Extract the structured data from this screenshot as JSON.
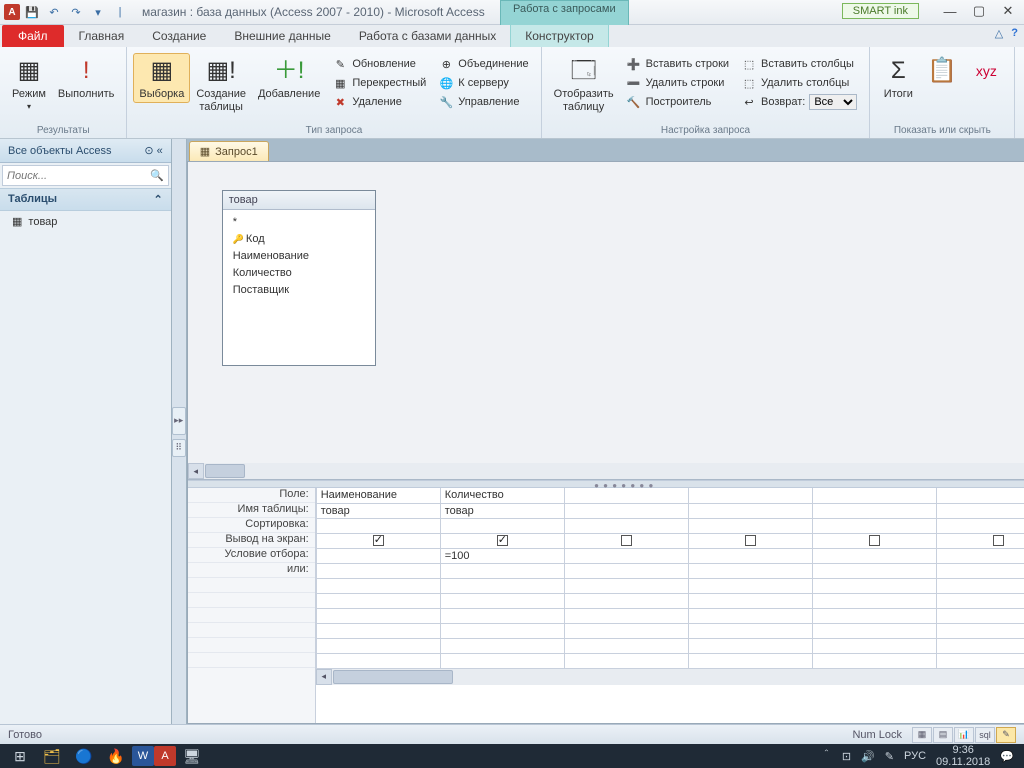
{
  "title_bar": {
    "app_title": "магазин : база данных (Access 2007 - 2010)  -  Microsoft Access",
    "context_tab_title": "Работа с запросами",
    "smart_ink": "SMART ink"
  },
  "ribbon_tabs": {
    "file": "Файл",
    "home": "Главная",
    "create": "Создание",
    "external": "Внешние данные",
    "db_tools": "Работа с базами данных",
    "designer": "Конструктор"
  },
  "ribbon": {
    "results": {
      "label": "Результаты",
      "view": "Режим",
      "run": "Выполнить"
    },
    "query_type": {
      "label": "Тип запроса",
      "select": "Выборка",
      "make_table": "Создание\nтаблицы",
      "append": "Добавление",
      "update": "Обновление",
      "crosstab": "Перекрестный",
      "delete": "Удаление",
      "union": "Объединение",
      "passthrough": "К серверу",
      "data_def": "Управление"
    },
    "setup": {
      "label": "Настройка запроса",
      "show_table": "Отобразить\nтаблицу",
      "insert_rows": "Вставить строки",
      "delete_rows": "Удалить строки",
      "builder": "Построитель",
      "insert_cols": "Вставить столбцы",
      "delete_cols": "Удалить столбцы",
      "return": "Возврат:",
      "return_val": "Все"
    },
    "show_hide": {
      "label": "Показать или скрыть",
      "totals": "Итоги"
    }
  },
  "nav": {
    "header": "Все объекты Access",
    "search_ph": "Поиск...",
    "cat_tables": "Таблицы",
    "item_tovar": "товар"
  },
  "doc": {
    "tab": "Запрос1"
  },
  "table_box": {
    "title": "товар",
    "star": "*",
    "f_key": "Код",
    "f_name": "Наименование",
    "f_qty": "Количество",
    "f_sup": "Поставщик"
  },
  "grid": {
    "labels": {
      "field": "Поле:",
      "table": "Имя таблицы:",
      "sort": "Сортировка:",
      "show": "Вывод на экран:",
      "criteria": "Условие отбора:",
      "or": "или:"
    },
    "cols": [
      {
        "field": "Наименование",
        "table": "товар",
        "sort": "",
        "show": true,
        "criteria": "",
        "or": ""
      },
      {
        "field": "Количество",
        "table": "товар",
        "sort": "",
        "show": true,
        "criteria": "=100",
        "or": ""
      },
      {
        "field": "",
        "table": "",
        "sort": "",
        "show": false,
        "criteria": "",
        "or": ""
      },
      {
        "field": "",
        "table": "",
        "sort": "",
        "show": false,
        "criteria": "",
        "or": ""
      },
      {
        "field": "",
        "table": "",
        "sort": "",
        "show": false,
        "criteria": "",
        "or": ""
      },
      {
        "field": "",
        "table": "",
        "sort": "",
        "show": false,
        "criteria": "",
        "or": ""
      }
    ]
  },
  "status": {
    "ready": "Готово",
    "numlock": "Num Lock"
  },
  "taskbar": {
    "time": "9:36",
    "date": "09.11.2018",
    "lang": "РУС"
  }
}
